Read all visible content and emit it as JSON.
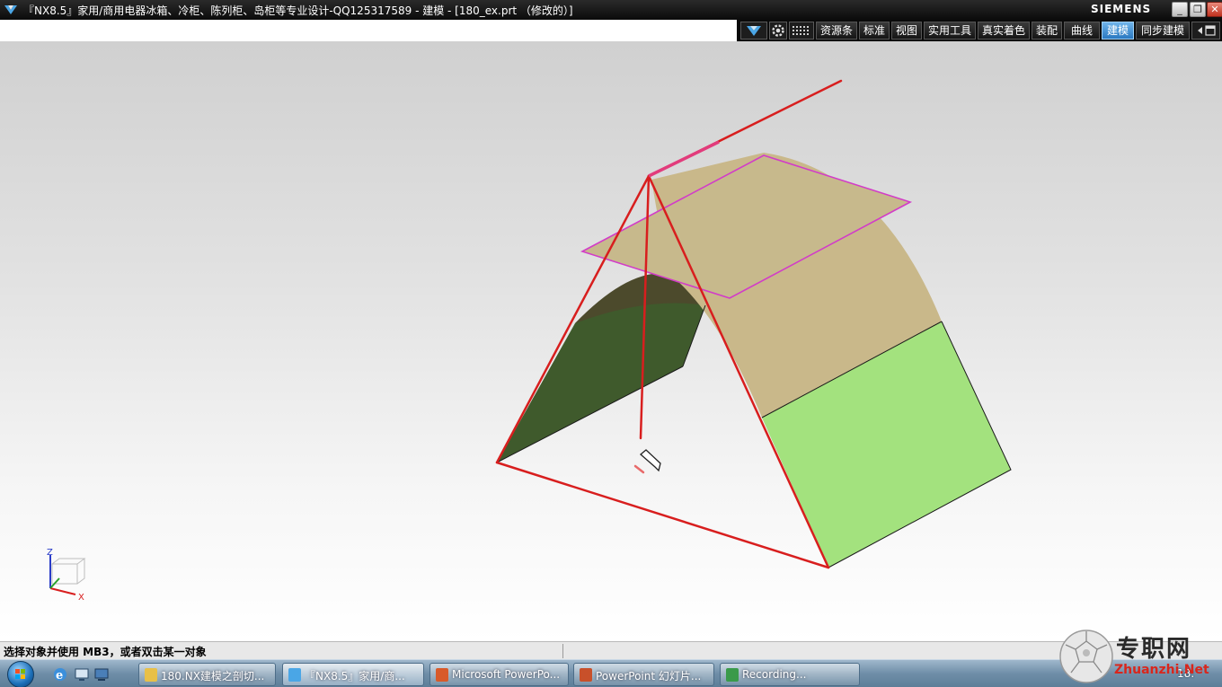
{
  "window": {
    "title": "『NX8.5』家用/商用电器冰箱、冷柜、陈列柜、岛柜等专业设计-QQ125317589 - 建模 - [180_ex.prt （修改的）]",
    "brand": "SIEMENS",
    "controls": {
      "minimize": "_",
      "restore": "❐",
      "close": "✕"
    }
  },
  "ribbon": {
    "tabs": [
      {
        "label": "资源条",
        "active": false
      },
      {
        "label": "标准",
        "active": false
      },
      {
        "label": "视图",
        "active": false
      },
      {
        "label": "实用工具",
        "active": false
      },
      {
        "label": "真实着色",
        "active": false
      },
      {
        "label": "装配",
        "active": false
      },
      {
        "label": "曲线",
        "active": false
      },
      {
        "label": "建模",
        "active": true
      },
      {
        "label": "同步建模",
        "active": false
      }
    ],
    "icons": [
      "nx-logo-icon",
      "gear-icon",
      "grid-icon",
      "ribbon-expand-icon"
    ]
  },
  "viewport": {
    "triad": {
      "z": "Z",
      "x": "X"
    },
    "colors": {
      "sketch_line": "#d81e1e",
      "plane_edge": "#d23cc8",
      "surface_tan": "#c9b88a",
      "surface_light_green": "#a3e27e",
      "surface_dark_green": "#3f5a2c"
    }
  },
  "status": {
    "prompt": "选择对象并使用 MB3，或者双击某一对象"
  },
  "taskbar": {
    "items": [
      {
        "label": "180.NX建模之剖切...",
        "icon": "folder-icon",
        "active": false
      },
      {
        "label": "『NX8.5』家用/商...",
        "icon": "nx-logo-icon",
        "active": true
      },
      {
        "label": "Microsoft PowerPo...",
        "icon": "powerpoint-icon",
        "active": false
      },
      {
        "label": "PowerPoint 幻灯片...",
        "icon": "slideshow-icon",
        "active": false
      },
      {
        "label": "Recording...",
        "icon": "recording-icon",
        "active": false
      }
    ],
    "clock": "18:"
  },
  "watermark": {
    "cn": "专职网",
    "en": "Zhuanzhi.Net"
  }
}
